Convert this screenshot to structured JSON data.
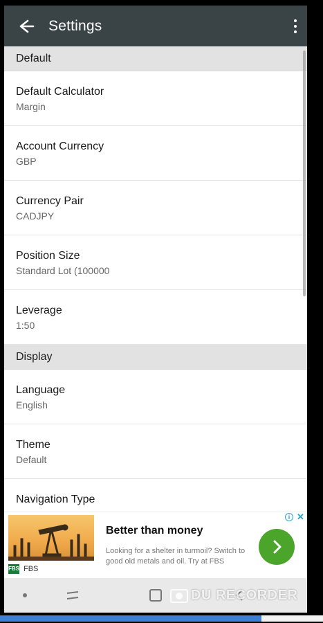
{
  "toolbar": {
    "title": "Settings",
    "back_icon": "arrow-left-icon",
    "more_icon": "more-vert-icon"
  },
  "sections": [
    {
      "header": "Default",
      "items": [
        {
          "title": "Default Calculator",
          "value": "Margin"
        },
        {
          "title": "Account Currency",
          "value": "GBP"
        },
        {
          "title": "Currency Pair",
          "value": "CADJPY"
        },
        {
          "title": "Position Size",
          "value": "Standard Lot (100000"
        },
        {
          "title": "Leverage",
          "value": "1:50"
        }
      ]
    },
    {
      "header": "Display",
      "items": [
        {
          "title": "Language",
          "value": "English"
        },
        {
          "title": "Theme",
          "value": "Default"
        },
        {
          "title": "Navigation Type",
          "value": ""
        }
      ]
    }
  ],
  "ad": {
    "headline": "Better than money",
    "body": "Looking for a shelter in turmoil? Switch to good old metals and oil. Try at FBS",
    "advertiser": "FBS",
    "badge": "FBS",
    "info_icon": "i",
    "close_icon": "✕",
    "cta_color": "#4aa52a"
  },
  "recorder": {
    "label": "DU RECORDER"
  },
  "colors": {
    "toolbar": "#3a4447",
    "accent": "#3d7fd6",
    "section_bg": "#e2e2e2"
  },
  "progress": {
    "fraction": 0.81
  }
}
